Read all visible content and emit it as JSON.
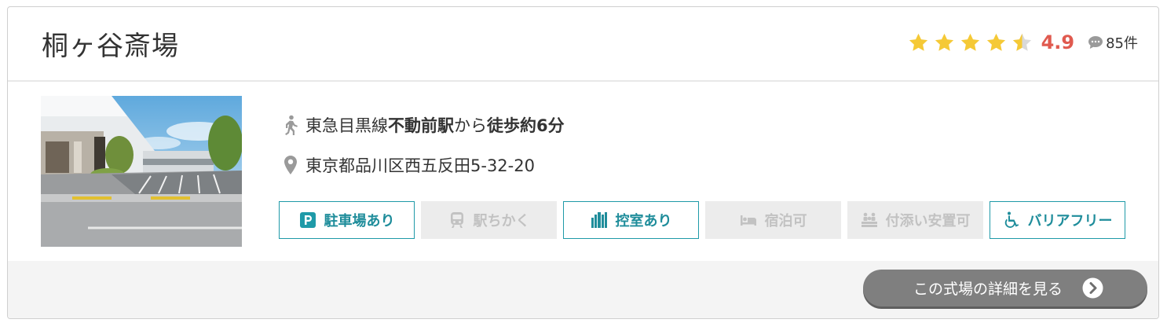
{
  "hall": {
    "name": "桐ヶ谷斎場",
    "rating": {
      "score": "4.9",
      "stars_value": 4.5,
      "stars_max": 5,
      "review_count": "85件",
      "star_color": "#f5c936",
      "star_empty_color": "#d9d9d9"
    },
    "photo_icon": "funeral-hall-photo",
    "access": {
      "icon": "walking-person-icon",
      "line": "東急目黒線 ",
      "station": "不動前駅",
      "from": "から",
      "walk": "徒歩約6分"
    },
    "address": {
      "icon": "map-pin-icon",
      "text": "東京都品川区西五反田5-32-20"
    },
    "features": [
      {
        "label": "駐車場あり",
        "icon": "parking-icon",
        "available": true
      },
      {
        "label": "駅ちかく",
        "icon": "train-icon",
        "available": false
      },
      {
        "label": "控室あり",
        "icon": "waiting-room-icon",
        "available": true
      },
      {
        "label": "宿泊可",
        "icon": "bed-icon",
        "available": false
      },
      {
        "label": "付添い安置可",
        "icon": "people-icon",
        "available": false
      },
      {
        "label": "バリアフリー",
        "icon": "wheelchair-icon",
        "available": true
      }
    ],
    "detail_button": "この式場の詳細を見る"
  },
  "colors": {
    "accent": "#1f9aa8",
    "score": "#e05a4f",
    "button_bg": "#7f7f7f"
  }
}
